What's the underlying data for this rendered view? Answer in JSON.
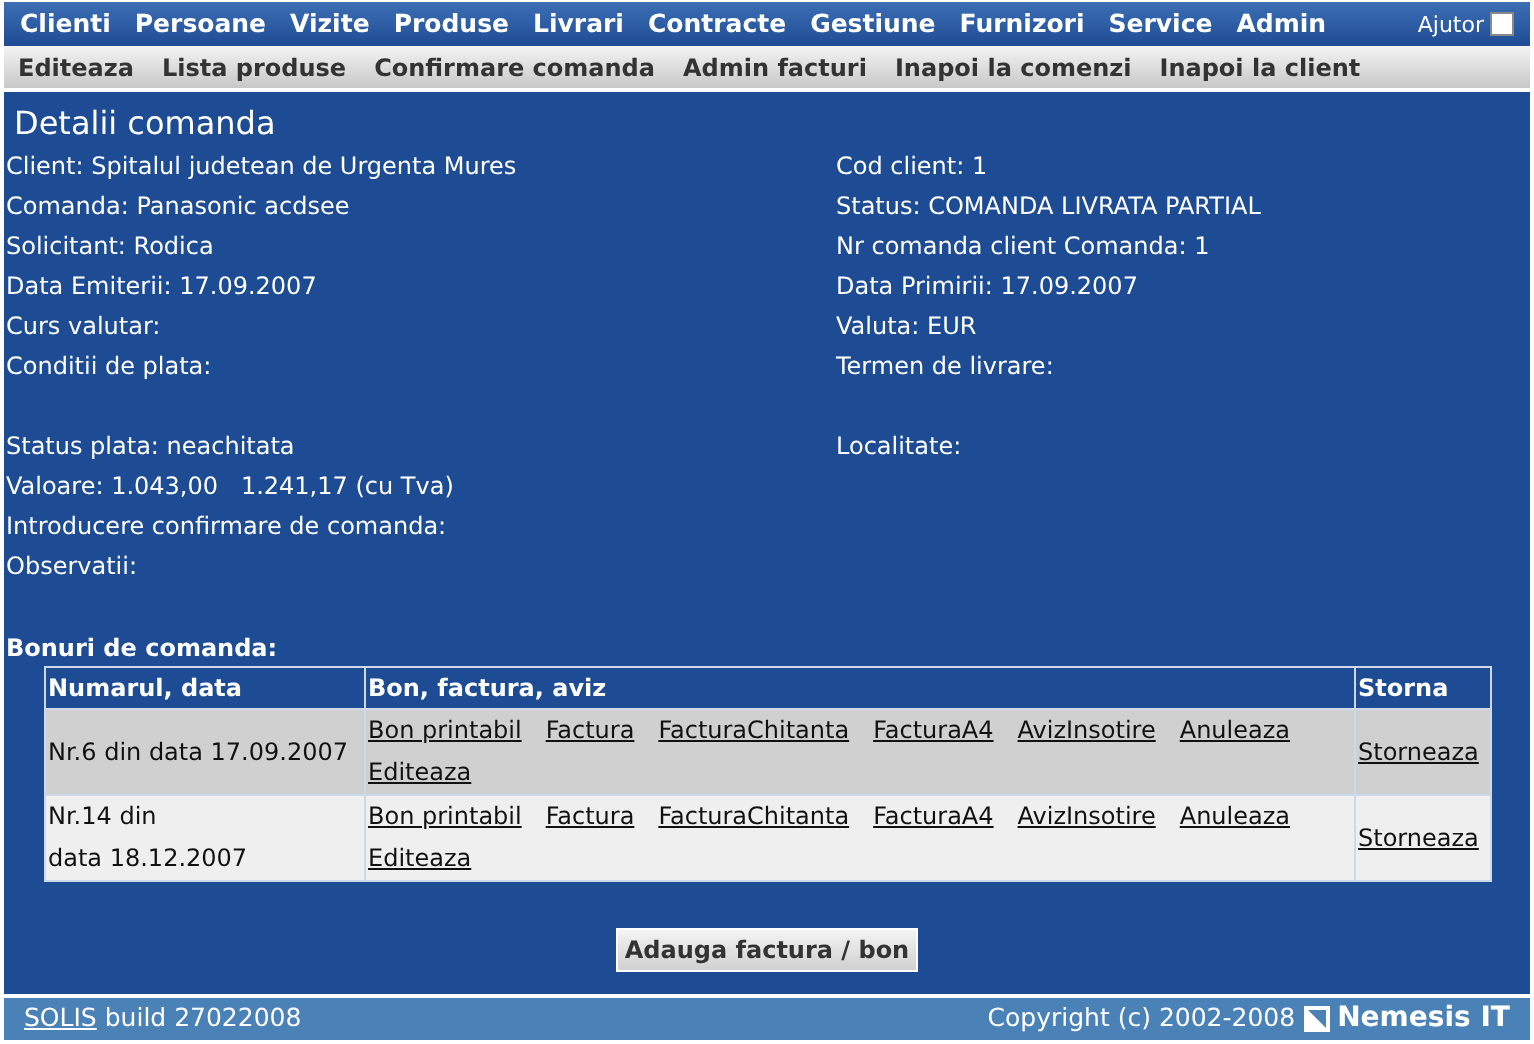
{
  "main_menu": [
    "Clienti",
    "Persoane",
    "Vizite",
    "Produse",
    "Livrari",
    "Contracte",
    "Gestiune",
    "Furnizori",
    "Service",
    "Admin"
  ],
  "help": {
    "label": "Ajutor",
    "checked": false
  },
  "sub_menu": [
    "Editeaza",
    "Lista produse",
    "Confirmare comanda",
    "Admin facturi",
    "Inapoi la comenzi",
    "Inapoi la client"
  ],
  "title": "Detalii comanda",
  "details": [
    {
      "kind": "pair",
      "left": "Client: Spitalul judetean de Urgenta Mures",
      "right": "Cod client: 1"
    },
    {
      "kind": "pair",
      "left": "Comanda: Panasonic acdsee",
      "right": "Status: COMANDA LIVRATA PARTIAL"
    },
    {
      "kind": "pair",
      "left": "Solicitant: Rodica",
      "right": "Nr comanda client Comanda: 1"
    },
    {
      "kind": "pair",
      "left": "Data Emiterii: 17.09.2007",
      "right": "Data Primirii: 17.09.2007"
    },
    {
      "kind": "pair",
      "left": "Curs valutar:",
      "right": "Valuta: EUR"
    },
    {
      "kind": "pair",
      "left": "Conditii de plata:",
      "right": "Termen de livrare:"
    },
    {
      "kind": "spacer"
    },
    {
      "kind": "pair",
      "left": "Status plata: neachitata",
      "right": "Localitate:"
    },
    {
      "kind": "single",
      "left": "Valoare: 1.043,00   1.241,17 (cu Tva)"
    },
    {
      "kind": "single",
      "left": "Introducere confirmare de comanda:"
    },
    {
      "kind": "single",
      "left": "Observatii:"
    }
  ],
  "orders": {
    "label": "Bonuri de comanda:",
    "columns": [
      "Numarul, data",
      "Bon, factura, aviz",
      "Storna"
    ],
    "rows": [
      {
        "number": [
          "Nr.6 din data 17.09.2007"
        ],
        "links": [
          "Bon printabil",
          "Factura",
          "FacturaChitanta",
          "FacturaA4",
          "AvizInsotire",
          "Anuleaza",
          "Editeaza"
        ],
        "storno": "Storneaza"
      },
      {
        "number": [
          "Nr.14 din",
          "data 18.12.2007"
        ],
        "links": [
          "Bon printabil",
          "Factura",
          "FacturaChitanta",
          "FacturaA4",
          "AvizInsotire",
          "Anuleaza",
          "Editeaza"
        ],
        "storno": "Storneaza"
      }
    ]
  },
  "add_button": "Adauga factura / bon",
  "footer": {
    "product": "SOLIS",
    "build": "build 27022008",
    "copyright": "Copyright (c) 2002-2008",
    "brand": "Nemesis IT"
  }
}
